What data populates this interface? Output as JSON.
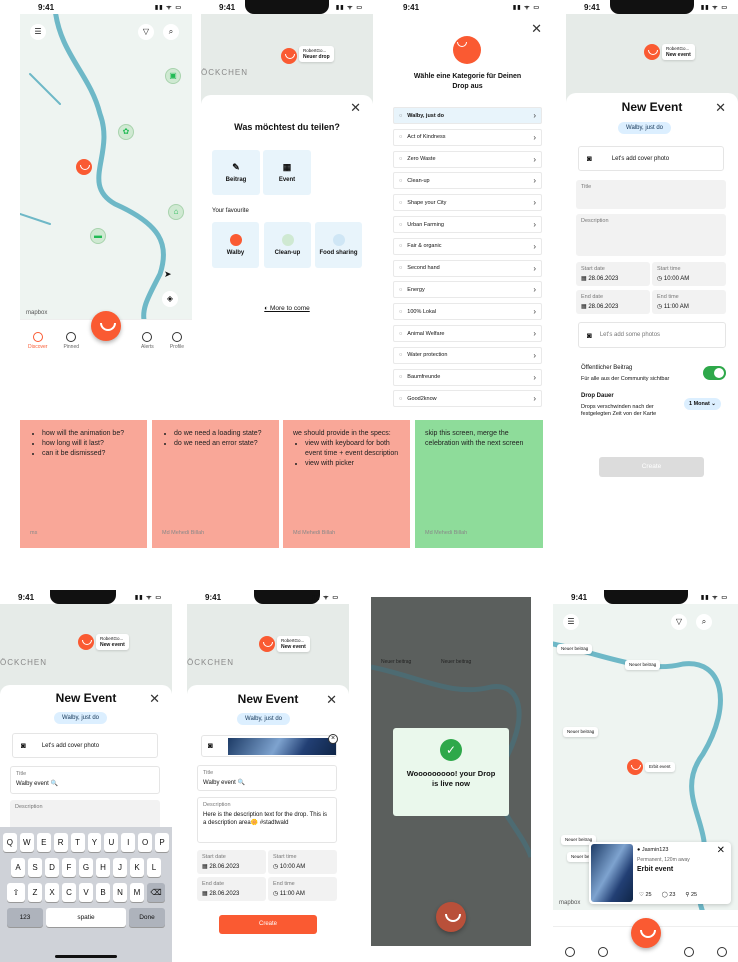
{
  "status": {
    "time": "9:41"
  },
  "p1": {
    "mapbox": "mapbox",
    "tabs": [
      "Discover",
      "Pinned",
      "Alerts",
      "Profile"
    ]
  },
  "p2": {
    "place": "ÖCKCHEN",
    "callout_user": "RobertGo...",
    "callout_title": "Neuer drop",
    "question": "Was möchtest du teilen?",
    "opt1": "Beitrag",
    "opt2": "Event",
    "fav_title": "Your favourite",
    "fav": [
      "Walby",
      "Clean-up",
      "Food sharing"
    ],
    "more": "More to come"
  },
  "p3": {
    "title": "Wähle eine Kategorie für Deinen Drop aus",
    "categories": [
      "Walby, just do",
      "Act of Kindness",
      "Zero Waste",
      "Clean-up",
      "Shape your City",
      "Urban Farming",
      "Fair & organic",
      "Second hand",
      "Energy",
      "100% Lokal",
      "Animal Welfare",
      "Water protection",
      "Baumfreunde",
      "Good2know"
    ]
  },
  "p4": {
    "callout_user": "RobertGo...",
    "callout_title": "New event",
    "title": "New Event",
    "chip": "Walby, just do",
    "cover": "Let's add cover photo",
    "title_lbl": "Title",
    "desc_lbl": "Description",
    "start_date_lbl": "Start date",
    "start_date": "28.06.2023",
    "start_time_lbl": "Start time",
    "start_time": "10:00 AM",
    "end_date_lbl": "End date",
    "end_date": "28.06.2023",
    "end_time_lbl": "End time",
    "end_time": "11:00 AM",
    "photos": "Let's add some photos",
    "public_title": "Öffentlicher Beitrag",
    "public_sub": "Für alle aus der Community sichtbar",
    "drop_title": "Drop Dauer",
    "drop_sub": "Drops verschwinden nach der festgelegten Zeit von der Karte",
    "drop_val": "1 Monat",
    "create": "Create"
  },
  "notes": [
    {
      "items": [
        "how will the animation be?",
        "how long will it last?",
        "can it be dismissed?"
      ],
      "author": "ms"
    },
    {
      "items": [
        "do we need a loading state?",
        "do we need an error state?"
      ],
      "author": "Md Mehedi Billah"
    },
    {
      "lead": "we should provide in the specs:",
      "items": [
        "view with keyboard for both event time + event description",
        "view with picker"
      ],
      "author": "Md Mehedi Billah"
    },
    {
      "text": "skip this screen, merge the celebration with the next screen",
      "author": "Md Mehedi Billah"
    }
  ],
  "p5": {
    "place": "ÖCKCHEN",
    "callout_user": "RobertGo...",
    "callout_title": "New event",
    "title": "New Event",
    "chip": "Walby, just do",
    "cover": "Let's add cover photo",
    "title_lbl": "Title",
    "title_val": "Walby event 🔍",
    "desc_lbl": "Description",
    "keys1": [
      "Q",
      "W",
      "E",
      "R",
      "T",
      "Y",
      "U",
      "I",
      "O",
      "P"
    ],
    "keys2": [
      "A",
      "S",
      "D",
      "F",
      "G",
      "H",
      "J",
      "K",
      "L"
    ],
    "keys3": [
      "Z",
      "X",
      "C",
      "V",
      "B",
      "N",
      "M"
    ],
    "num": "123",
    "space": "spatie",
    "done": "Done"
  },
  "p6": {
    "place": "ÖCKCHEN",
    "callout_user": "RobertGo...",
    "callout_title": "New event",
    "title": "New Event",
    "chip": "Walby, just do",
    "title_lbl": "Title",
    "title_val": "Walby event 🔍",
    "desc_lbl": "Description",
    "desc_val": "Here is the description text for the drop. This is a description area🌼 #stadtwald",
    "start_date_lbl": "Start date",
    "start_date": "28.06.2023",
    "start_time_lbl": "Start time",
    "start_time": "10:00 AM",
    "end_date_lbl": "End date",
    "end_date": "28.06.2023",
    "end_time_lbl": "End time",
    "end_time": "11:00 AM",
    "create": "Create"
  },
  "p7": {
    "label1": "Neuer beitrag",
    "label2": "Neuer beitrag",
    "success": "Wooooooooo! your Drop is live now"
  },
  "p8": {
    "labels": [
      "Neuer beitrag",
      "Neuer beitrag",
      "Neuer beitrag",
      "Erbit event",
      "Neuer beitrag",
      "Neuer beitrag"
    ],
    "card_user": "Jasmin123",
    "card_meta": "Permanent, 120m away",
    "card_title": "Erbit event",
    "likes": "25",
    "comments": "23",
    "pins": "25",
    "mapbox": "mapbox"
  }
}
